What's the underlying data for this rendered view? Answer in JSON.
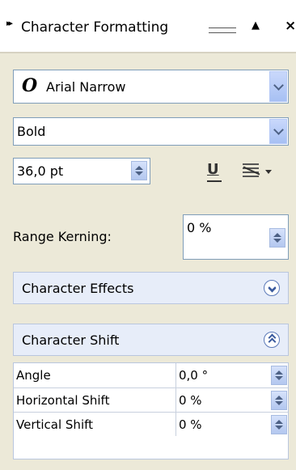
{
  "titlebar": {
    "title": "Character Formatting",
    "grip_icon": "double-arrow-icon",
    "collapse_icon": "triangle-up-icon",
    "close_icon": "close-icon"
  },
  "font": {
    "family": "Arial Narrow",
    "type_icon": "opentype-font-icon",
    "style": "Bold",
    "size": "36,0 pt"
  },
  "toolbar": {
    "underline_icon": "underline-icon",
    "strikethrough_icon": "strikethrough-icon",
    "menu_icon": "dropdown-arrow-icon"
  },
  "kerning": {
    "label": "Range Kerning:",
    "value": "0 %"
  },
  "sections": {
    "effects": "Character Effects",
    "shift": "Character Shift"
  },
  "shift_rows": [
    {
      "label": "Angle",
      "value": "0,0 °"
    },
    {
      "label": "Horizontal Shift",
      "value": "0 %"
    },
    {
      "label": "Vertical Shift",
      "value": "0 %"
    }
  ],
  "colors": {
    "panel_bg": "#ece9d8",
    "accent": "#7f9db9",
    "section_bg": "#e7edf9"
  }
}
